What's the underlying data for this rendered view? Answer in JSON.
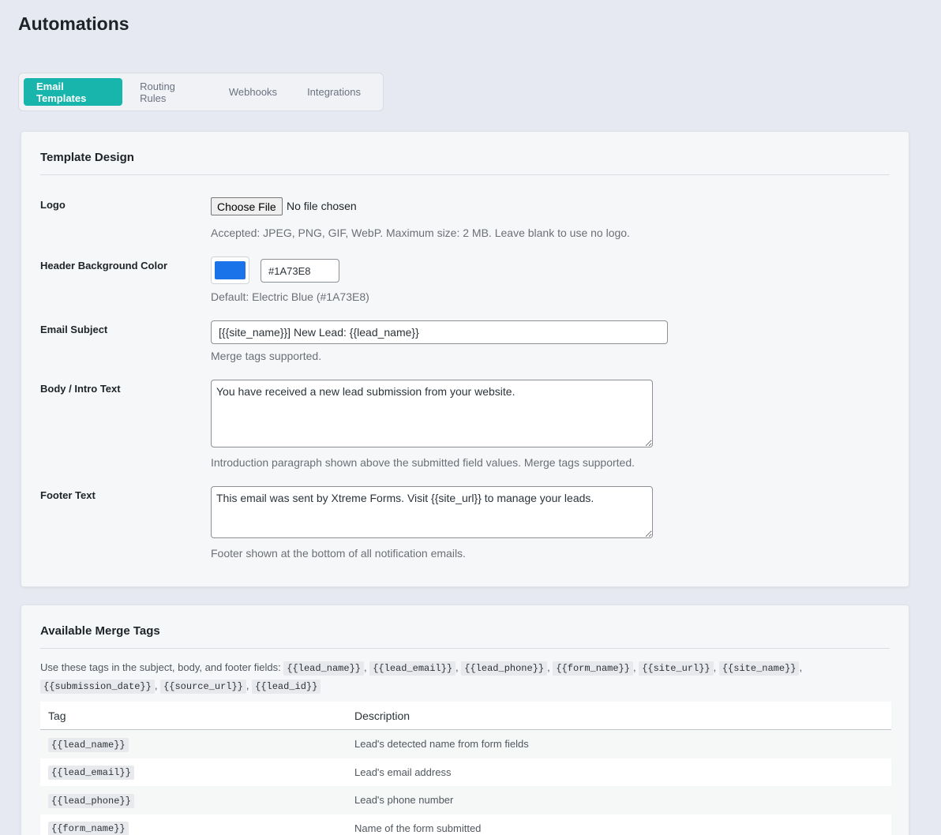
{
  "page": {
    "title": "Automations"
  },
  "tabs": [
    {
      "label": "Email Templates",
      "active": true
    },
    {
      "label": "Routing Rules",
      "active": false
    },
    {
      "label": "Webhooks",
      "active": false
    },
    {
      "label": "Integrations",
      "active": false
    }
  ],
  "template_design": {
    "title": "Template Design",
    "logo": {
      "label": "Logo",
      "button": "Choose File",
      "status": "No file chosen",
      "help": "Accepted: JPEG, PNG, GIF, WebP. Maximum size: 2 MB. Leave blank to use no logo."
    },
    "header_color": {
      "label": "Header Background Color",
      "swatch_color": "#1A73E8",
      "value": "#1A73E8",
      "help": "Default: Electric Blue (#1A73E8)"
    },
    "subject": {
      "label": "Email Subject",
      "value": "[{{site_name}}] New Lead: {{lead_name}}",
      "help": "Merge tags supported."
    },
    "body": {
      "label": "Body / Intro Text",
      "value": "You have received a new lead submission from your website.",
      "help": "Introduction paragraph shown above the submitted field values. Merge tags supported."
    },
    "footer": {
      "label": "Footer Text",
      "value": "This email was sent by Xtreme Forms. Visit {{site_url}} to manage your leads.",
      "help": "Footer shown at the bottom of all notification emails."
    }
  },
  "merge_tags": {
    "title": "Available Merge Tags",
    "intro": "Use these tags in the subject, body, and footer fields:",
    "tags": [
      "{{lead_name}}",
      "{{lead_email}}",
      "{{lead_phone}}",
      "{{form_name}}",
      "{{site_url}}",
      "{{site_name}}",
      "{{submission_date}}",
      "{{source_url}}",
      "{{lead_id}}"
    ],
    "table": {
      "headers": {
        "tag": "Tag",
        "description": "Description"
      },
      "rows": [
        {
          "tag": "{{lead_name}}",
          "description": "Lead's detected name from form fields"
        },
        {
          "tag": "{{lead_email}}",
          "description": "Lead's email address"
        },
        {
          "tag": "{{lead_phone}}",
          "description": "Lead's phone number"
        },
        {
          "tag": "{{form_name}}",
          "description": "Name of the form submitted"
        }
      ]
    }
  },
  "colors": {
    "accent": "#17B5AC",
    "swatch": "#1A73E8",
    "background": "#E6E9F1"
  }
}
